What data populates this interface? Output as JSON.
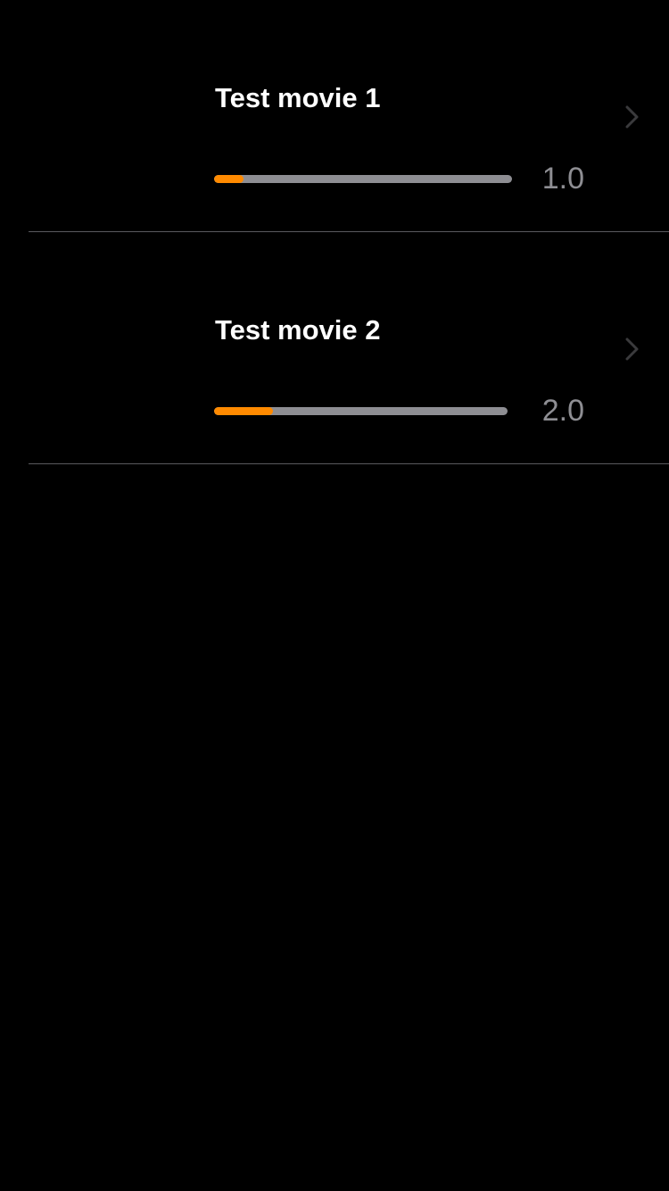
{
  "colors": {
    "background": "#000000",
    "title": "#ffffff",
    "track": "#8e8e93",
    "fill": "#ff8a00",
    "rating": "#8e8e93",
    "chevron": "#3a3a3c",
    "divider": "#5a5a5e"
  },
  "movies": [
    {
      "title": "Test movie 1",
      "rating": "1.0",
      "progress": 0.1,
      "chevron_icon": "chevron-right-icon"
    },
    {
      "title": "Test movie 2",
      "rating": "2.0",
      "progress": 0.2,
      "chevron_icon": "chevron-right-icon"
    }
  ]
}
